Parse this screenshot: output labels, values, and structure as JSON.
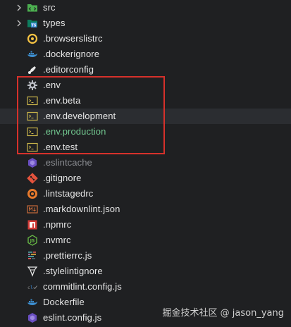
{
  "tree": {
    "items": [
      {
        "label": "src",
        "icon": "folder-src-icon",
        "chevron": true
      },
      {
        "label": "types",
        "icon": "folder-ts-icon",
        "chevron": true
      },
      {
        "label": ".browserslistrc",
        "icon": "browserslist-icon"
      },
      {
        "label": ".dockerignore",
        "icon": "docker-icon"
      },
      {
        "label": ".editorconfig",
        "icon": "editorconfig-icon"
      },
      {
        "label": ".env",
        "icon": "gear-icon"
      },
      {
        "label": ".env.beta",
        "icon": "terminal-file-icon"
      },
      {
        "label": ".env.development",
        "icon": "terminal-file-icon"
      },
      {
        "label": ".env.production",
        "icon": "terminal-file-icon"
      },
      {
        "label": ".env.test",
        "icon": "terminal-file-icon"
      },
      {
        "label": ".eslintcache",
        "icon": "eslint-icon"
      },
      {
        "label": ".gitignore",
        "icon": "git-icon"
      },
      {
        "label": ".lintstagedrc",
        "icon": "lintstaged-icon"
      },
      {
        "label": ".markdownlint.json",
        "icon": "markdownlint-icon"
      },
      {
        "label": ".npmrc",
        "icon": "npm-icon"
      },
      {
        "label": ".nvmrc",
        "icon": "nodejs-icon"
      },
      {
        "label": ".prettierrc.js",
        "icon": "prettier-icon"
      },
      {
        "label": ".stylelintignore",
        "icon": "stylelint-icon"
      },
      {
        "label": "commitlint.config.js",
        "icon": "commitlint-icon"
      },
      {
        "label": "Dockerfile",
        "icon": "docker-icon"
      },
      {
        "label": "eslint.config.js",
        "icon": "eslint-icon"
      }
    ]
  },
  "colors": {
    "highlight_box": "#d6312b",
    "modified_text": "#73c991",
    "ignored_text": "#8b8d92"
  },
  "watermark": "掘金技术社区 @ jason_yang"
}
